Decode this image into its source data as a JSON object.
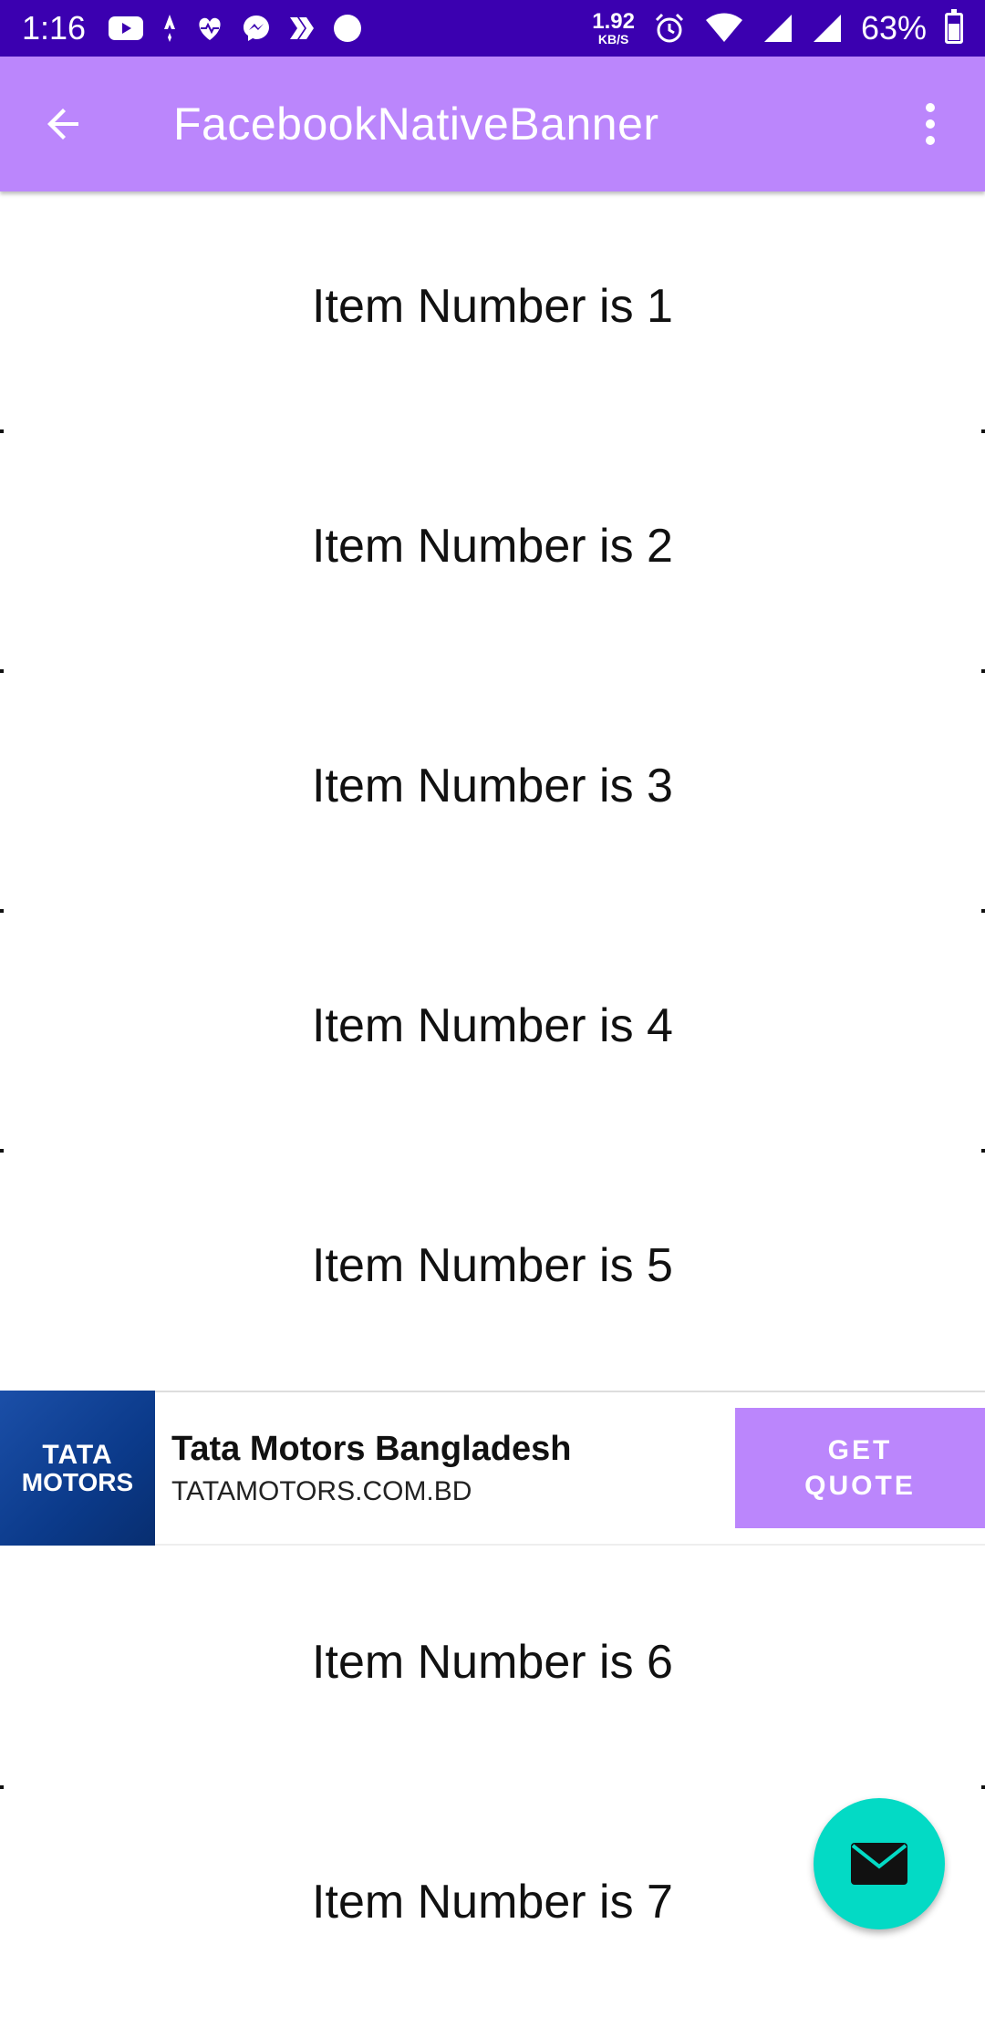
{
  "status_bar": {
    "time": "1:16",
    "net_speed_value": "1.92",
    "net_speed_unit": "KB/S",
    "battery": "63%",
    "battery_level": 0.63,
    "icons": [
      "youtube-icon",
      "strava-icon",
      "health-icon",
      "messenger-icon",
      "chevrons-icon",
      "circle-icon",
      "alarm-icon",
      "wifi-icon",
      "signal-icon",
      "signal-icon",
      "battery-icon"
    ]
  },
  "app_bar": {
    "title": "FacebookNativeBanner",
    "back_icon": "arrow-back-icon",
    "menu_icon": "more-vert-icon",
    "color": "#bb86fc"
  },
  "items_top": [
    {
      "label": "Item Number is 1"
    },
    {
      "label": "Item Number is 2"
    },
    {
      "label": "Item Number is 3"
    },
    {
      "label": "Item Number is 4"
    },
    {
      "label": "Item Number is 5"
    }
  ],
  "ad": {
    "logo_line1": "TATA",
    "logo_line2": "MOTORS",
    "title": "Tata Motors Bangladesh",
    "url": "TATAMOTORS.COM.BD",
    "cta_line1": "GET",
    "cta_line2": "QUOTE"
  },
  "items_bottom": [
    {
      "label": "Item Number is 6"
    },
    {
      "label": "Item Number is 7"
    }
  ],
  "fab": {
    "icon": "mail-icon",
    "color": "#03dac5"
  },
  "colors": {
    "status_bar": "#3b00b0",
    "accent": "#bb86fc",
    "fab": "#03dac5"
  }
}
